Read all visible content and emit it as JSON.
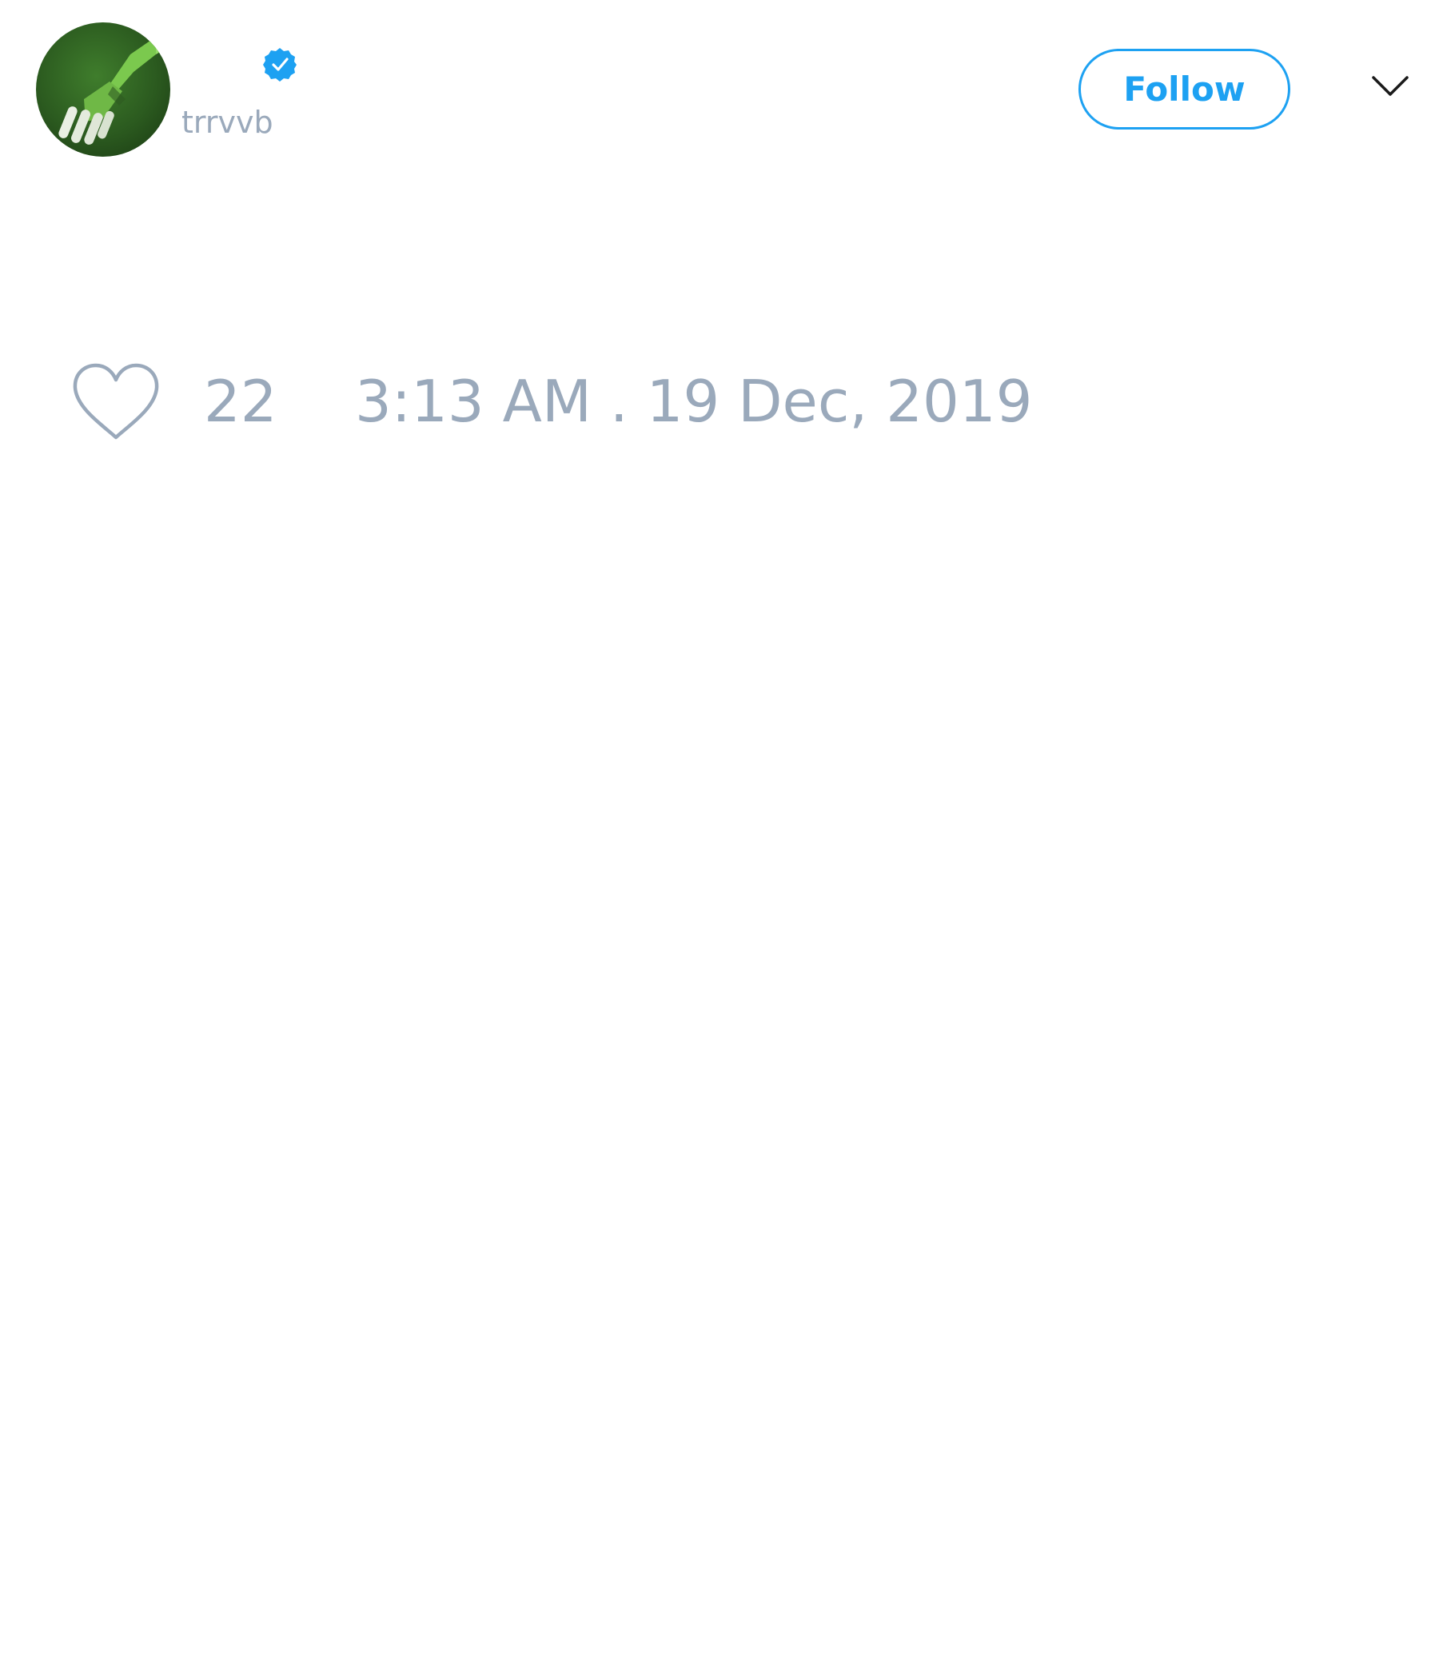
{
  "tweet": {
    "author": {
      "handle": "trrvvb",
      "verified": true,
      "avatar_icon": "green-hand-avatar"
    },
    "follow_label": "Follow",
    "menu_icon": "chevron-down-icon",
    "likes": {
      "icon": "heart-outline-icon",
      "count": "22"
    },
    "timestamp": "3:13 AM . 19 Dec, 2019"
  },
  "colors": {
    "accent": "#1da1f2",
    "muted_text": "#9aa9bb",
    "background": "#ffffff"
  }
}
